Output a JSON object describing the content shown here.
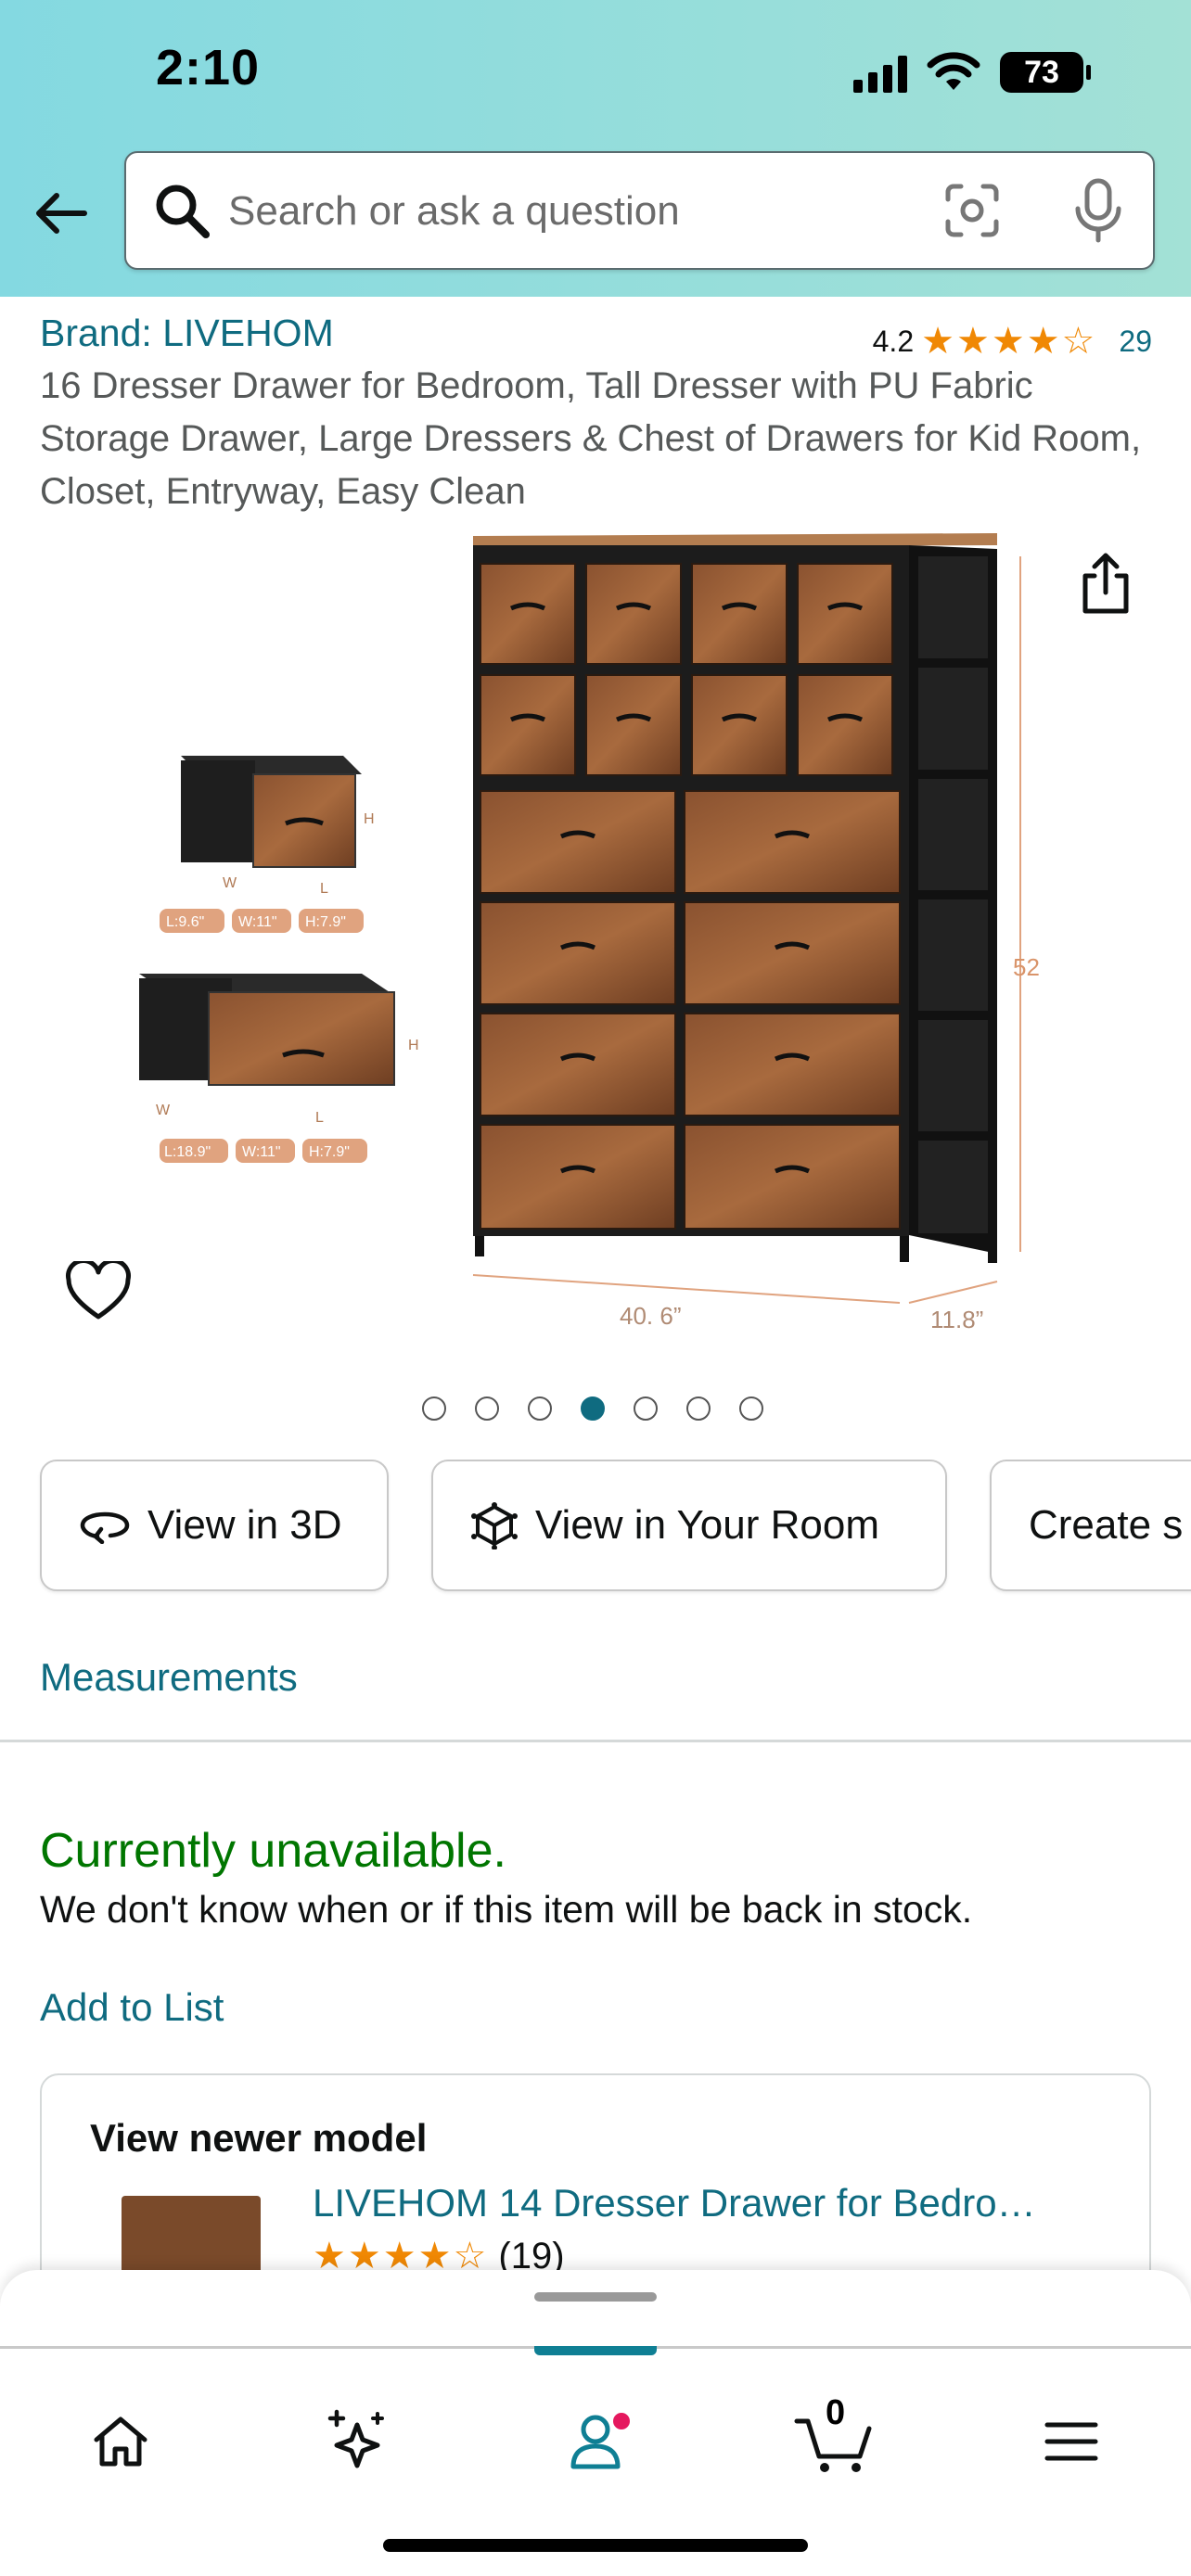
{
  "status_bar": {
    "time": "2:10",
    "battery": "73"
  },
  "search": {
    "placeholder": "Search or ask a question"
  },
  "product": {
    "brand": "Brand: LIVEHOM",
    "rating": "4.2",
    "rating_count": "29",
    "title": "16 Dresser Drawer for Bedroom, Tall Dresser with PU Fabric Storage Drawer, Large Dressers & Chest of Drawers for Kid Room, Closet, Entryway, Easy Clean"
  },
  "image": {
    "height_label": "52\"",
    "width_label": "40. 6”",
    "depth_label": "11.8”",
    "small_drawer": {
      "l": "L:9.6\"",
      "w": "W:11\"",
      "h": "H:7.9\""
    },
    "large_drawer": {
      "l": "L:18.9\"",
      "w": "W:11\"",
      "h": "H:7.9\""
    },
    "dim_letters": {
      "w": "W",
      "l": "L",
      "h": "H"
    }
  },
  "gallery": {
    "total": 7,
    "active_index": 3
  },
  "chips": [
    {
      "label": "View in 3D",
      "icon": "rotate-3d-icon"
    },
    {
      "label": "View in Your Room",
      "icon": "ar-cube-icon"
    },
    {
      "label": "Create s",
      "icon": ""
    }
  ],
  "links": {
    "measurements": "Measurements",
    "add_to_list": "Add to List"
  },
  "availability": {
    "status": "Currently unavailable.",
    "note": "We don't know when or if this item will be back in stock."
  },
  "newer_model": {
    "heading": "View newer model",
    "name": "LIVEHOM 14 Dresser Drawer for Bedro…",
    "rating_count": "(19)"
  },
  "nav": {
    "cart_count": "0"
  },
  "colors": {
    "link": "#0f6b80",
    "available": "#007600",
    "star": "#f08804",
    "header_start": "#84d9e1",
    "header_end": "#a3e1d6"
  }
}
